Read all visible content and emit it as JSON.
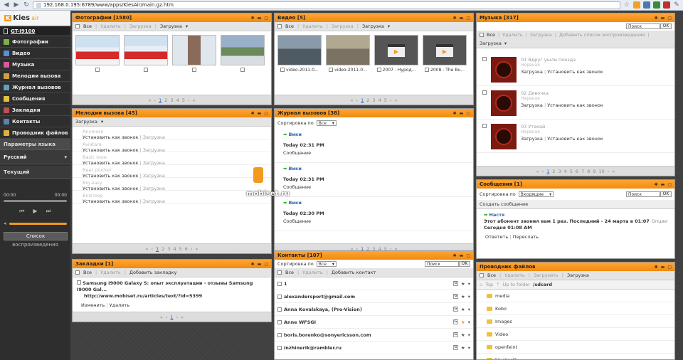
{
  "browser": {
    "url": "192.168.0.195:6789/www/apps/KiesAir/main.gz.htm"
  },
  "sidebar": {
    "logo": "Kies",
    "logo_sub": "air",
    "device": "GT-I9100",
    "items": [
      {
        "label": "Фотографии",
        "icon": "photo-icon",
        "color": "#7ab34c"
      },
      {
        "label": "Видео",
        "icon": "video-icon",
        "color": "#5a8fd0"
      },
      {
        "label": "Музыка",
        "icon": "music-icon",
        "color": "#d45a9a"
      },
      {
        "label": "Мелодии вызова",
        "icon": "ringtone-icon",
        "color": "#d0a040"
      },
      {
        "label": "Журнал вызовов",
        "icon": "call-log-icon",
        "color": "#60a0c0"
      },
      {
        "label": "Сообщения",
        "icon": "message-icon",
        "color": "#e0c040"
      },
      {
        "label": "Закладки",
        "icon": "bookmark-icon",
        "color": "#c05050"
      },
      {
        "label": "Контакты",
        "icon": "contacts-icon",
        "color": "#6080b0"
      },
      {
        "label": "Проводник файлов",
        "icon": "folder-icon",
        "color": "#e0b040"
      }
    ],
    "lang_section": "Параметры языка",
    "lang_value": "Русский",
    "current_section": "Текущий",
    "time_start": "00:00",
    "time_end": "00:00",
    "list_button": "Список",
    "list_sub": "воспроизведения"
  },
  "photos": {
    "title": "Фотографии [1580]",
    "all": "Все",
    "delete": "Удалить",
    "upload": "Загрузка",
    "download": "Загрузка",
    "thumbs": [
      {
        "bg": "linear-gradient(#cfe0ef 0 40%,#e8eef5 40% 55%,#d42a2a 55% 80%,#f2f2f2 80%)"
      },
      {
        "bg": "linear-gradient(#cfe0ef 0 35%,#e8eef5 35% 55%,#d42a2a 55% 80%,#f2f2f2 80%)"
      },
      {
        "bg": "linear-gradient(90deg,#dfe6ee 0 35%,#8a6a5a 35% 65%,#dfe6ee 65%)"
      },
      {
        "bg": "linear-gradient(#9ab0c8 0 40%,#6a8a5a 40% 70%,#d8dde2 70%)"
      }
    ],
    "pager": {
      "pages": [
        "1",
        "2",
        "3",
        "4",
        "5"
      ]
    }
  },
  "video": {
    "title": "Видео [5]",
    "all": "Все",
    "delete": "Удалить",
    "upload": "Загрузка",
    "download": "Загрузка",
    "thumbs": [
      {
        "label": "video-2011-0...",
        "bg": "linear-gradient(#8a9aa8 0 45%,#505a62 45%)"
      },
      {
        "label": "video-2011-0...",
        "bg": "linear-gradient(#b0a890 0 45%,#7a7262 45%)"
      },
      {
        "label": "2007 - Нурод...",
        "bg": "#555"
      },
      {
        "label": "2008 - The Bu...",
        "bg": "#555"
      }
    ],
    "pager": {
      "pages": [
        "1",
        "2",
        "3",
        "4",
        "5"
      ]
    }
  },
  "music": {
    "title": "Музыка [317]",
    "search_ok": "OK",
    "search_placeholder": "Поиск",
    "all": "Все",
    "delete": "Удалить",
    "upload": "Загрузка",
    "add_playlist": "Добавить список воспроизведения",
    "download": "Загрузка",
    "tracks": [
      {
        "title": "01 Вдруг ушли поезда",
        "artist": "Нервная"
      },
      {
        "title": "02 Девочка",
        "artist": "Нервная"
      },
      {
        "title": "03 Утекай",
        "artist": "Нервная"
      }
    ],
    "track_download": "Загрузка",
    "track_ringtone": "Установить как звонок",
    "pager": {
      "pages": [
        "1",
        "2",
        "3",
        "4",
        "5",
        "6",
        "7",
        "8",
        "9",
        "10"
      ]
    }
  },
  "ringtones": {
    "title": "Мелодии вызова [45]",
    "download": "Загрузка",
    "items": [
      "Anymore",
      "Aviatara",
      "Basic tone",
      "Beat plucker",
      "Big easy",
      "Bird loop"
    ],
    "set_ringtone": "Установить как звонок",
    "item_download": "Загрузка",
    "pager": {
      "pages": [
        "1",
        "2",
        "3",
        "4",
        "5",
        "6"
      ]
    }
  },
  "calllog": {
    "title": "Журнал вызовов [38]",
    "sort_label": "Сортировка по",
    "sort_value": "Все",
    "calls": [
      {
        "name": "Вики",
        "time": "Today 02:31 PM",
        "action": "Сообщение"
      },
      {
        "name": "Вики",
        "time": "Today 02:31 PM",
        "action": "Сообщение"
      },
      {
        "name": "Вики",
        "time": "Today 02:30 PM",
        "action": "Сообщение"
      }
    ],
    "pager": {
      "pages": [
        "1",
        "2",
        "3",
        "4",
        "5"
      ]
    }
  },
  "messages": {
    "title": "Сообщения [1]",
    "sort_label": "Сортировка по",
    "sort_value": "Входящие",
    "search_placeholder": "Поиск",
    "search_ok": "OK",
    "create": "Создать сообщение",
    "sender": "Настя",
    "text": "Этот абонент звонил вам 1 раз. Последний - 24 марта в 01:07 //...",
    "options": "Опции",
    "time": "Сегодня 01:08 AM",
    "reply": "Ответить",
    "forward": "Переслать"
  },
  "bookmarks": {
    "title": "Закладки [1]",
    "all": "Все",
    "delete": "Удалить",
    "add": "Добавить закладку",
    "item_title": "Samsung I9000 Galaxy S: опыт эксплуатации - отзывы Samsung I9000 Gal...",
    "item_url": "http://www.mobiset.ru/articles/text/?id=5399",
    "edit": "Изменить",
    "remove": "Удалить",
    "pager": {
      "pages": [
        "1"
      ]
    }
  },
  "contacts": {
    "title": "Контакты [107]",
    "sort_label": "Сортировка по",
    "sort_value": "Все",
    "search_placeholder": "Поиск",
    "search_ok": "OK",
    "all": "Все",
    "delete": "Удалить",
    "add": "Добавить контакт",
    "items": [
      "1",
      "alexandersport@gmail.com",
      "Anna Kovalskaya, (Pro-Vision)",
      "Anne WFSGI",
      "boris.borenko@sonyericsson.com",
      "inzhinerik@rambler.ru"
    ]
  },
  "files": {
    "title": "Проводник файлов",
    "all": "Все",
    "delete": "Удалить",
    "upload": "Загрузить",
    "download": "Загрузка",
    "top": "Top",
    "up": "Up to folder",
    "path": "/sdcard",
    "folders": [
      "media",
      "Kobo",
      "Images",
      "Video",
      "openfeint",
      "bluetooth"
    ]
  },
  "watermark": "mobiset.ru"
}
